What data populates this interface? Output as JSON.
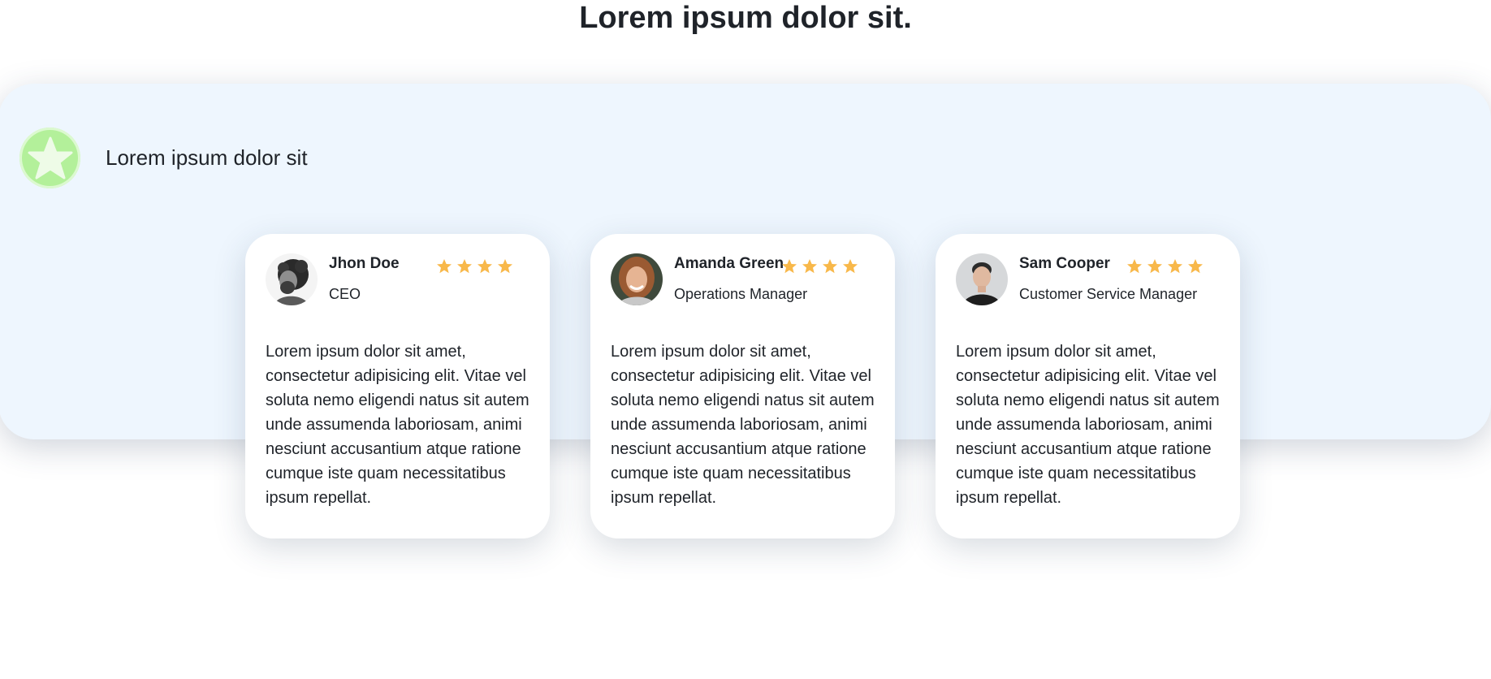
{
  "page": {
    "title": "Lorem ipsum dolor sit."
  },
  "panel": {
    "heading": "Lorem ipsum dolor sit",
    "badge_icon": "star-icon",
    "badge_color": "#b3f09a",
    "background_color": "#eef6fe"
  },
  "star_color": "#f8b84a",
  "testimonials": [
    {
      "name": "Jhon Doe",
      "role": "CEO",
      "rating": 4,
      "text": "Lorem ipsum dolor sit amet, consectetur adipisicing elit. Vitae vel soluta nemo eligendi natus sit autem unde assumenda laboriosam, animi nesciunt accusantium atque ratione cumque iste quam necessitatibus ipsum repellat."
    },
    {
      "name": "Amanda Green",
      "role": "Operations Manager",
      "rating": 4,
      "text": "Lorem ipsum dolor sit amet, consectetur adipisicing elit. Vitae vel soluta nemo eligendi natus sit autem unde assumenda laboriosam, animi nesciunt accusantium atque ratione cumque iste quam necessitatibus ipsum repellat."
    },
    {
      "name": "Sam Cooper",
      "role": "Customer Service Manager",
      "rating": 4,
      "text": "Lorem ipsum dolor sit amet, consectetur adipisicing elit. Vitae vel soluta nemo eligendi natus sit autem unde assumenda laboriosam, animi nesciunt accusantium atque ratione cumque iste quam necessitatibus ipsum repellat."
    }
  ]
}
